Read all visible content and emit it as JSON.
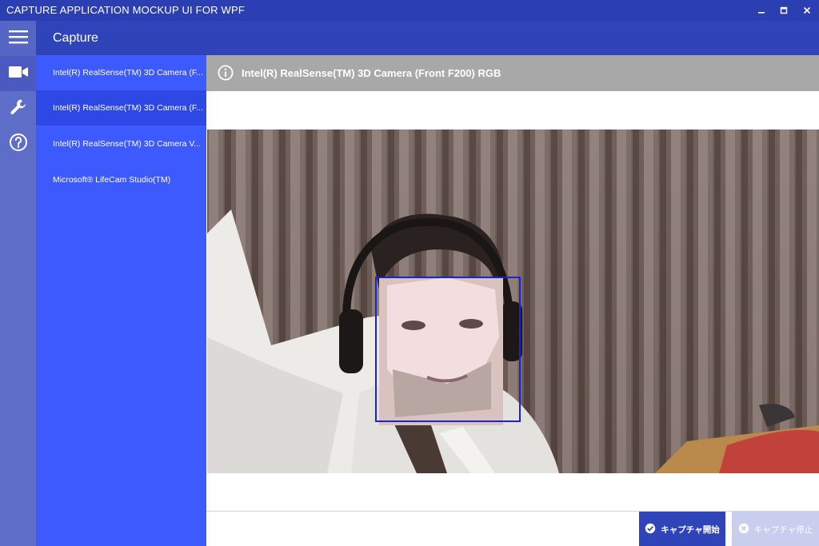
{
  "window": {
    "title": "CAPTURE APPLICATION MOCKUP UI FOR WPF"
  },
  "header": {
    "title": "Capture"
  },
  "rail": {
    "items": [
      "menu-icon",
      "camera-icon",
      "wrench-icon",
      "help-icon"
    ]
  },
  "devices": {
    "items": [
      {
        "label": "Intel(R) RealSense(TM) 3D Camera (F..."
      },
      {
        "label": "Intel(R) RealSense(TM) 3D Camera (F..."
      },
      {
        "label": "Intel(R) RealSense(TM) 3D Camera V..."
      },
      {
        "label": "Microsoft® LifeCam Studio(TM)"
      }
    ],
    "selected_index": 1
  },
  "info": {
    "text": "Intel(R) RealSense(TM) 3D Camera (Front F200) RGB"
  },
  "actions": {
    "start_label": "キャプチャ開始",
    "stop_label": "キャプチャ停止",
    "stop_enabled": false
  },
  "colors": {
    "titlebar": "#2b3fb3",
    "accent": "#3d5afe",
    "rail": "#5e6dc8",
    "info_bar": "#a8a8a8",
    "face_box": "#1d22d0"
  }
}
